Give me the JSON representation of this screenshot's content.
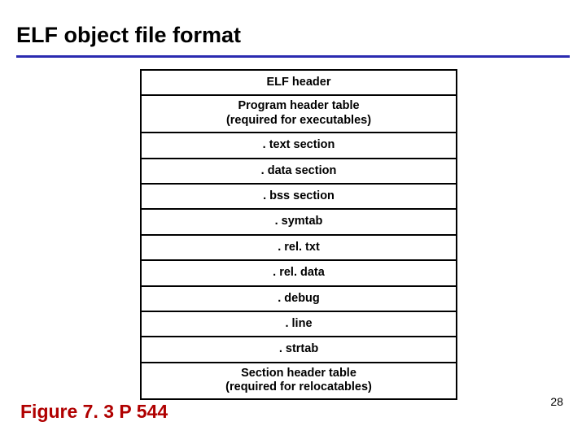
{
  "title": "ELF object file format",
  "sections": [
    "ELF header",
    "Program header table\n(required for executables)",
    ". text section",
    ". data section",
    ". bss section",
    ". symtab",
    ". rel. txt",
    ". rel. data",
    ". debug",
    ". line",
    ". strtab",
    "Section header table\n(required for relocatables)"
  ],
  "figure_caption": "Figure 7. 3  P 544",
  "page_number": "28"
}
